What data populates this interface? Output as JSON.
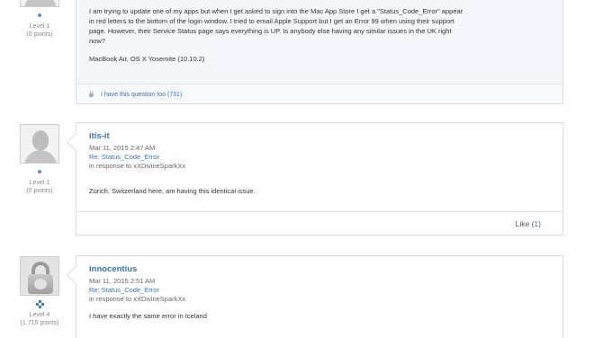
{
  "question": {
    "author": {
      "level": "Level 1",
      "points": "(0 points)"
    },
    "body": "I am trying to update one of my apps but when I get asked to sign into the Mac App Store I get a \"Status_Code_Error\" appear in red letters to the bottom of the login window. I tried to email Apple Support but I get an Error 99 when using their support page. However, their Service Status page says everything is UP. Is anybody else having any similar issues in the UK right now?",
    "device": "MacBook Air, OS X Yosemite (10.10.2)",
    "also_label": "I have this question too (731)"
  },
  "replies": [
    {
      "author": "itis-it",
      "level": "Level 1",
      "points": "(0 points)",
      "date": "Mar 11, 2015 2:47 AM",
      "re": "Re: Status_Code_Error",
      "in_response": "in response to xXDivineSparkXx",
      "text": "Zürich, Switzerland here, am having this identical issue.",
      "like_label": "Like (",
      "like_count": "1",
      "like_close": ")"
    },
    {
      "author": "innocentius",
      "level": "Level 4",
      "points": "(1,715 points)",
      "date": "Mar 11, 2015 2:51 AM",
      "re": "Re: Status_Code_Error",
      "in_response": "in response to xXDivineSparkXx",
      "text": "I have exactly the same error in Iceland"
    }
  ]
}
